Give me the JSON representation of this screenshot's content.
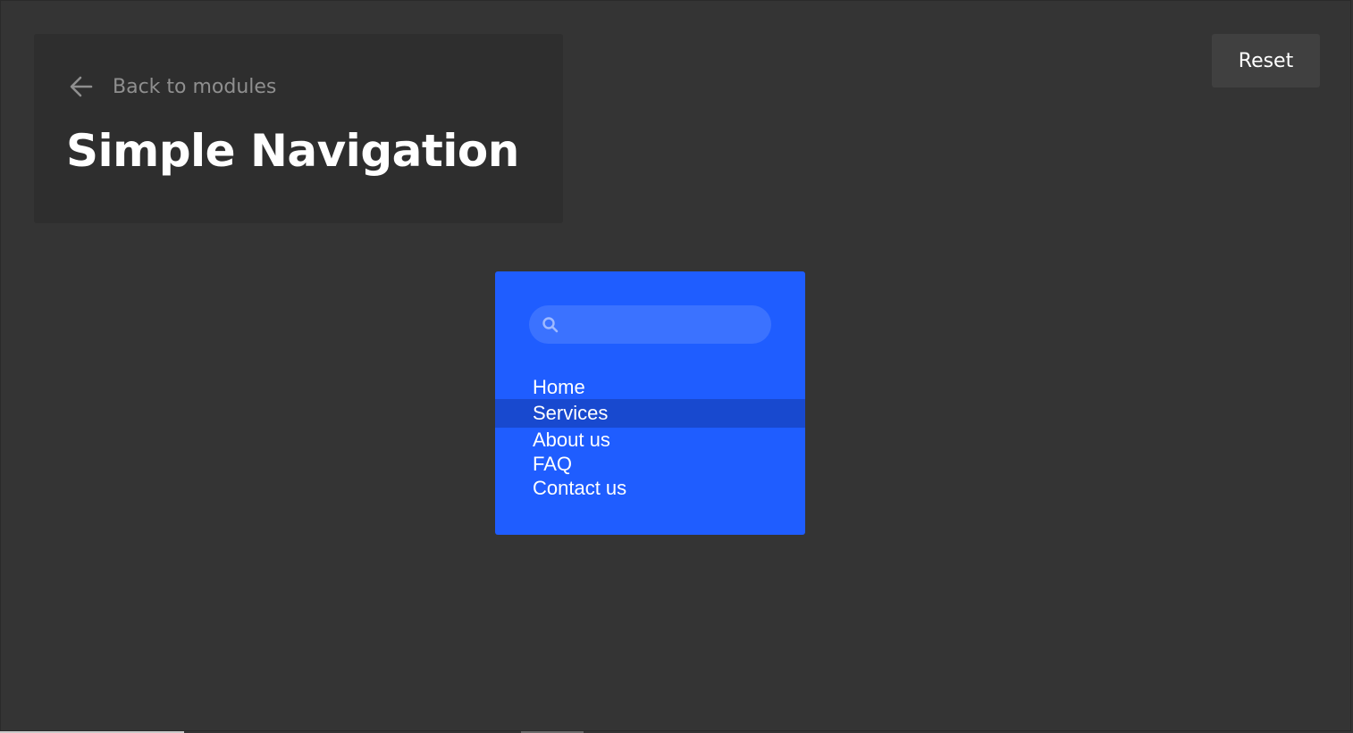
{
  "header": {
    "back_label": "Back to modules",
    "title": "Simple Navigation"
  },
  "toolbar": {
    "reset_label": "Reset"
  },
  "navigation": {
    "search": {
      "placeholder": "",
      "value": ""
    },
    "items": [
      {
        "label": "Home",
        "active": false
      },
      {
        "label": "Services",
        "active": true
      },
      {
        "label": "About us",
        "active": false
      },
      {
        "label": "FAQ",
        "active": false
      },
      {
        "label": "Contact us",
        "active": false
      }
    ]
  },
  "colors": {
    "page_background": "#343434",
    "header_card": "#2e2e2e",
    "reset_button": "#404040",
    "nav_card": "#1f5dff",
    "search_box": "#3b72ff",
    "active_item": "#1849cf",
    "muted_text": "#8f8f8f",
    "text": "#ffffff"
  },
  "icons": {
    "back": "arrow-left-icon",
    "search": "search-icon"
  }
}
